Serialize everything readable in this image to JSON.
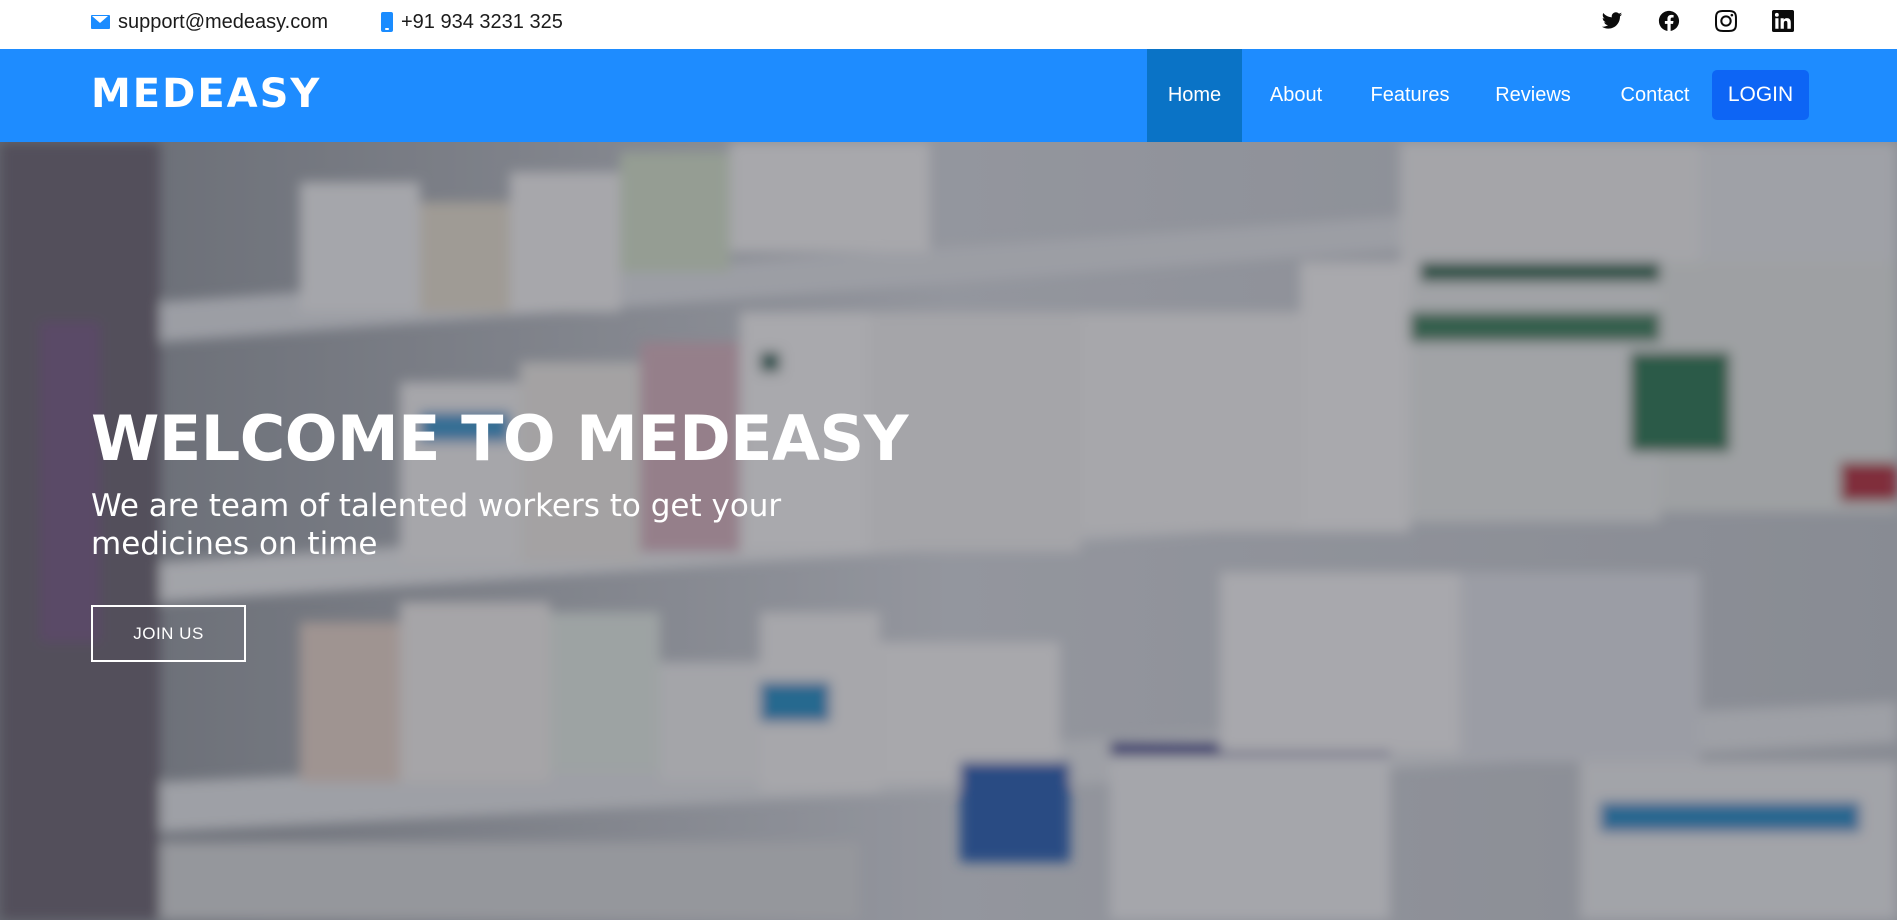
{
  "topbar": {
    "email": "support@medeasy.com",
    "phone": "+91 934 3231 325",
    "email_icon": "mail-icon",
    "phone_icon": "mobile-phone-icon",
    "social": [
      {
        "name": "twitter-icon"
      },
      {
        "name": "facebook-icon"
      },
      {
        "name": "instagram-icon"
      },
      {
        "name": "linkedin-icon"
      }
    ]
  },
  "navbar": {
    "brand": "MEDEASY",
    "items": [
      {
        "label": "Home",
        "active": true
      },
      {
        "label": "About",
        "active": false
      },
      {
        "label": "Features",
        "active": false
      },
      {
        "label": "Reviews",
        "active": false
      },
      {
        "label": "Contact",
        "active": false
      }
    ],
    "login_label": "LOGIN"
  },
  "hero": {
    "title": "WELCOME TO MEDEASY",
    "subtitle": "We are team of talented workers to get your medicines on time",
    "cta_label": "JOIN US",
    "background": "pharmacy-shelves-photo"
  },
  "colors": {
    "navbar_bg": "#1e8cff",
    "nav_active_bg": "#0a73c6",
    "login_bg": "#0d65f5",
    "icon_accent": "#1a8cff"
  }
}
